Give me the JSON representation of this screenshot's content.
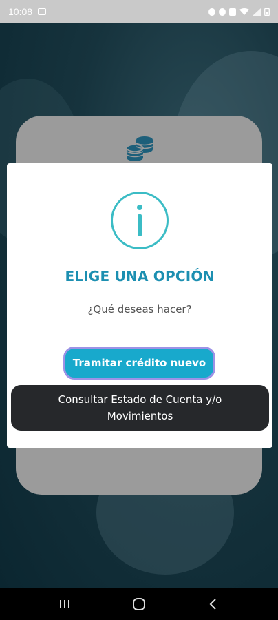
{
  "status_bar": {
    "time": "10:08",
    "left_icons": [
      "image-icon"
    ],
    "right_icons": [
      "notification-icon",
      "alarm-icon",
      "mute-icon",
      "wifi-icon",
      "signal-icon",
      "battery-icon"
    ]
  },
  "background": {
    "card_icon": "coins-icon"
  },
  "dialog": {
    "icon": "info-icon",
    "title": "ELIGE UNA OPCIÓN",
    "message": "¿Qué deseas hacer?",
    "primary_button": "Tramitar crédito nuevo",
    "secondary_button": "Consultar Estado de Cuenta y/o Movimientos"
  },
  "nav_bar": {
    "items": [
      "recents-button",
      "home-button",
      "back-button"
    ]
  },
  "colors": {
    "accent": "#1c8fb1",
    "primary_button": "#18a9cc",
    "primary_button_border": "#9d92e6",
    "secondary_button": "#26282b",
    "info_ring": "#3bbcc5"
  }
}
